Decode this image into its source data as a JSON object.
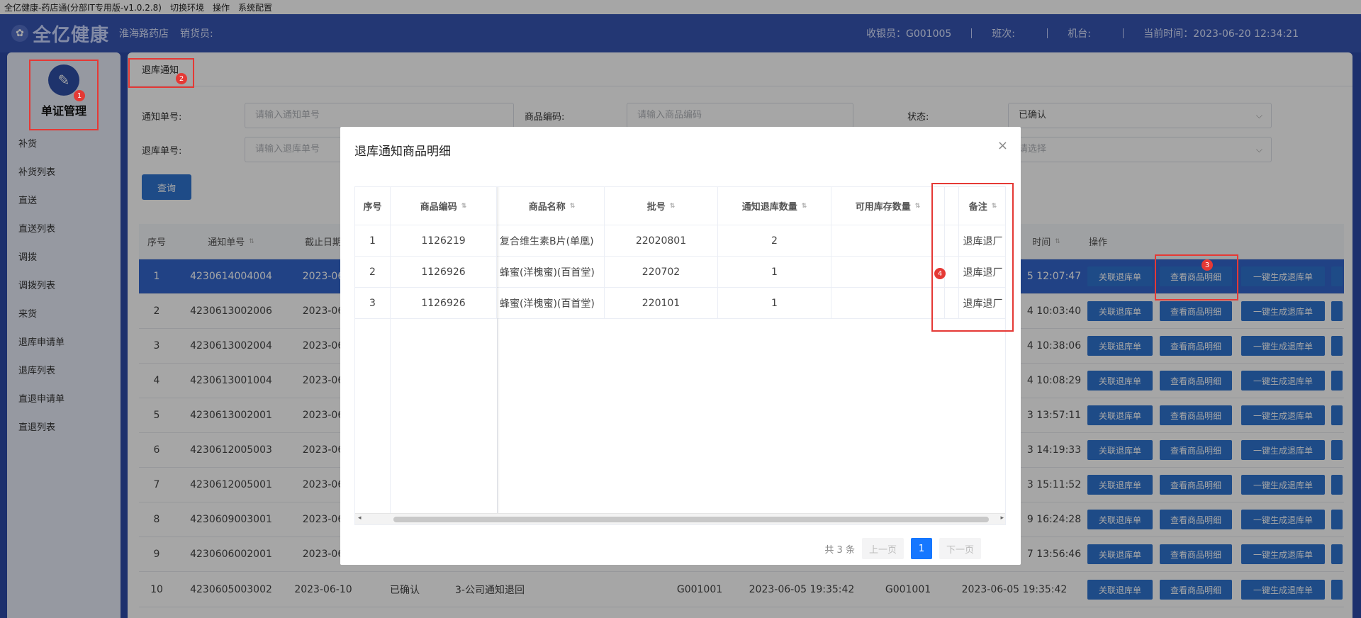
{
  "menubar": {
    "title": "全亿健康-药店通(分部IT专用版-v1.0.2.8)",
    "items": [
      "切换环境",
      "操作",
      "系统配置"
    ]
  },
  "header": {
    "logo": "全亿健康",
    "store": "淮海路药店",
    "seller_label": "销货员:",
    "cashier": "收银员：G001005",
    "shift": "班次:",
    "terminal": "机台:",
    "time": "当前时间：2023-06-20 12:34:21"
  },
  "sidebar": {
    "title": "单证管理",
    "items": [
      "补货",
      "补货列表",
      "直送",
      "直送列表",
      "调拨",
      "调拨列表",
      "来货",
      "退库申请单",
      "退库列表",
      "直退申请单",
      "直退列表"
    ]
  },
  "tab": {
    "label": "退库通知"
  },
  "filters": {
    "notice_no_label": "通知单号:",
    "notice_no_placeholder": "请输入通知单号",
    "product_code_label": "商品编码:",
    "product_code_placeholder": "请输入商品编码",
    "status_label": "状态:",
    "status_value": "已确认",
    "return_no_label": "退库单号:",
    "return_no_placeholder": "请输入退库单号",
    "select_placeholder": "请选择",
    "query_label": "查询"
  },
  "table": {
    "headers": {
      "index": "序号",
      "notice_no": "通知单号",
      "deadline": "截止日期",
      "time": "时间",
      "ops": "操作"
    },
    "rows": [
      {
        "i": "1",
        "no": "4230614004004",
        "date": "2023-06",
        "t": "5 12:07:47"
      },
      {
        "i": "2",
        "no": "4230613002006",
        "date": "2023-06",
        "t": "4 10:03:40"
      },
      {
        "i": "3",
        "no": "4230613002004",
        "date": "2023-06",
        "t": "4 10:38:06"
      },
      {
        "i": "4",
        "no": "4230613001004",
        "date": "2023-06",
        "t": "4 10:08:29"
      },
      {
        "i": "5",
        "no": "4230613002001",
        "date": "2023-06",
        "t": "3 13:57:11"
      },
      {
        "i": "6",
        "no": "4230612005003",
        "date": "2023-06",
        "t": "3 14:19:33"
      },
      {
        "i": "7",
        "no": "4230612005001",
        "date": "2023-06",
        "t": "3 15:11:52"
      },
      {
        "i": "8",
        "no": "4230609003001",
        "date": "2023-06",
        "t": "9 16:24:28"
      },
      {
        "i": "9",
        "no": "4230606002001",
        "date": "2023-06",
        "t": "7 13:56:46"
      }
    ],
    "last_row": {
      "i": "10",
      "no": "4230605003002",
      "date": "2023-06-10",
      "status": "已确认",
      "type": "3-公司通知退回",
      "user1": "G001001",
      "t1": "2023-06-05 19:35:42",
      "user2": "G001001",
      "t2": "2023-06-05 19:35:42"
    },
    "op_buttons": [
      "关联退库单",
      "查看商品明细",
      "一键生成退库单"
    ]
  },
  "dialog": {
    "title": "退库通知商品明细",
    "close": "×",
    "headers": [
      "序号",
      "商品编码",
      "商品名称",
      "批号",
      "通知退库数量",
      "可用库存数量",
      "备注"
    ],
    "rows": [
      [
        "1",
        "1126219",
        "复合维生素B片(单凰)",
        "22020801",
        "2",
        "",
        "退库退厂"
      ],
      [
        "2",
        "1126926",
        "蜂蜜(洋槐蜜)(百首堂)",
        "220702",
        "1",
        "",
        "退库退厂"
      ],
      [
        "3",
        "1126926",
        "蜂蜜(洋槐蜜)(百首堂)",
        "220101",
        "1",
        "",
        "退库退厂"
      ]
    ],
    "total": "共 3 条",
    "prev": "上一页",
    "page": "1",
    "next": "下一页"
  },
  "badges": [
    "1",
    "2",
    "3",
    "4"
  ],
  "colors": {
    "primary": "#2f74d0",
    "header": "#3655b3",
    "annotation": "#e53935"
  }
}
